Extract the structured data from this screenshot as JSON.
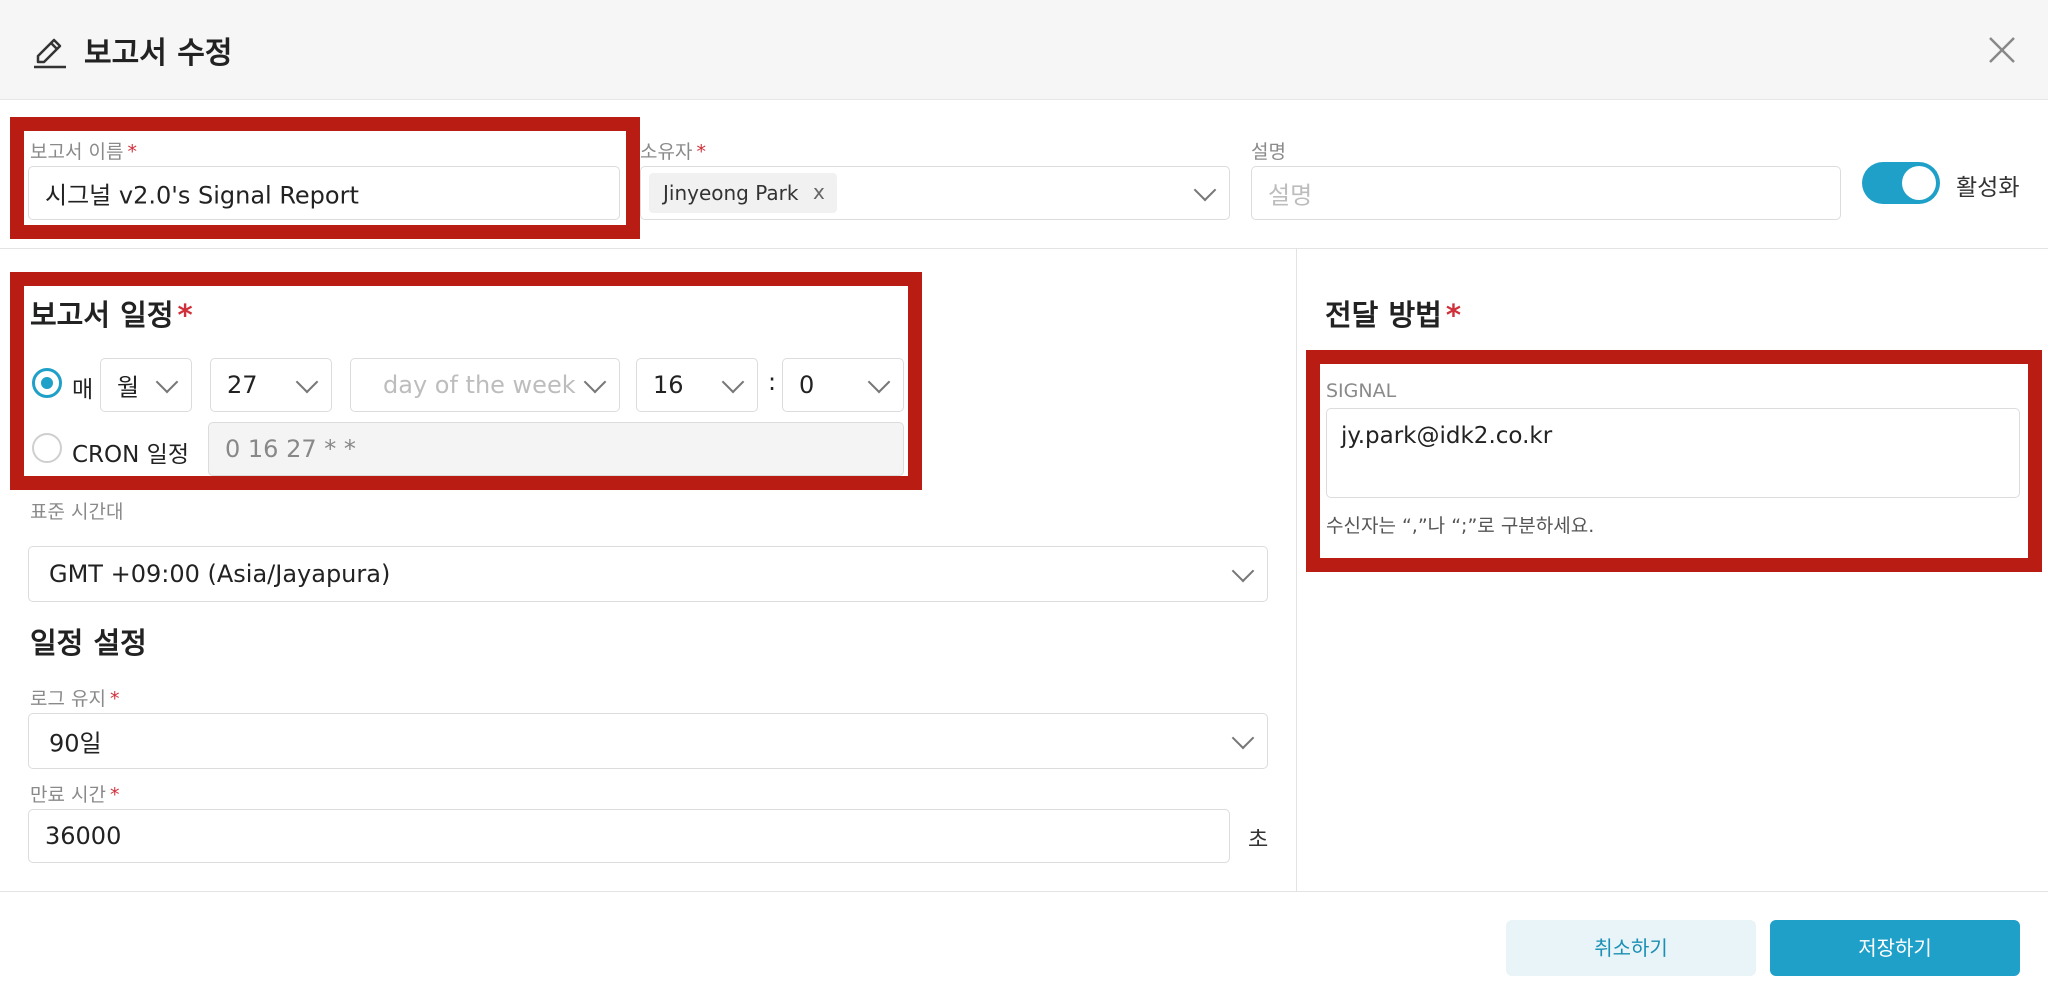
{
  "header": {
    "title": "보고서 수정"
  },
  "form": {
    "report_name": {
      "label": "보고서 이름",
      "value": "시그널 v2.0's Signal Report"
    },
    "owner": {
      "label": "소유자",
      "tag": "Jinyeong Park",
      "tag_remove": "x"
    },
    "description": {
      "label": "설명",
      "placeholder": "설명"
    },
    "active_toggle": {
      "label": "활성화",
      "on": true
    }
  },
  "schedule": {
    "heading": "보고서 일정",
    "every_label": "매",
    "unit": "월",
    "day": "27",
    "weekday_placeholder": "day of the week",
    "hour": "16",
    "colon": ":",
    "minute": "0",
    "cron_label": "CRON 일정",
    "cron_value": "0 16 27 * *",
    "timezone_label": "표준 시간대",
    "timezone_value": "GMT +09:00 (Asia/Jayapura)"
  },
  "settings": {
    "heading": "일정 설정",
    "log_label": "로그 유지",
    "log_value": "90일",
    "expire_label": "만료 시간",
    "expire_value": "36000",
    "expire_unit": "초"
  },
  "delivery": {
    "heading": "전달 방법",
    "channel_label": "SIGNAL",
    "recipients": "jy.park@idk2.co.kr",
    "hint": "수신자는 “,”나 “;”로 구분하세요."
  },
  "footer": {
    "cancel": "취소하기",
    "save": "저장하기"
  },
  "colors": {
    "accent": "#1fa0c8",
    "highlight": "#b81c12",
    "required": "#d0303a"
  },
  "required_mark": "*"
}
